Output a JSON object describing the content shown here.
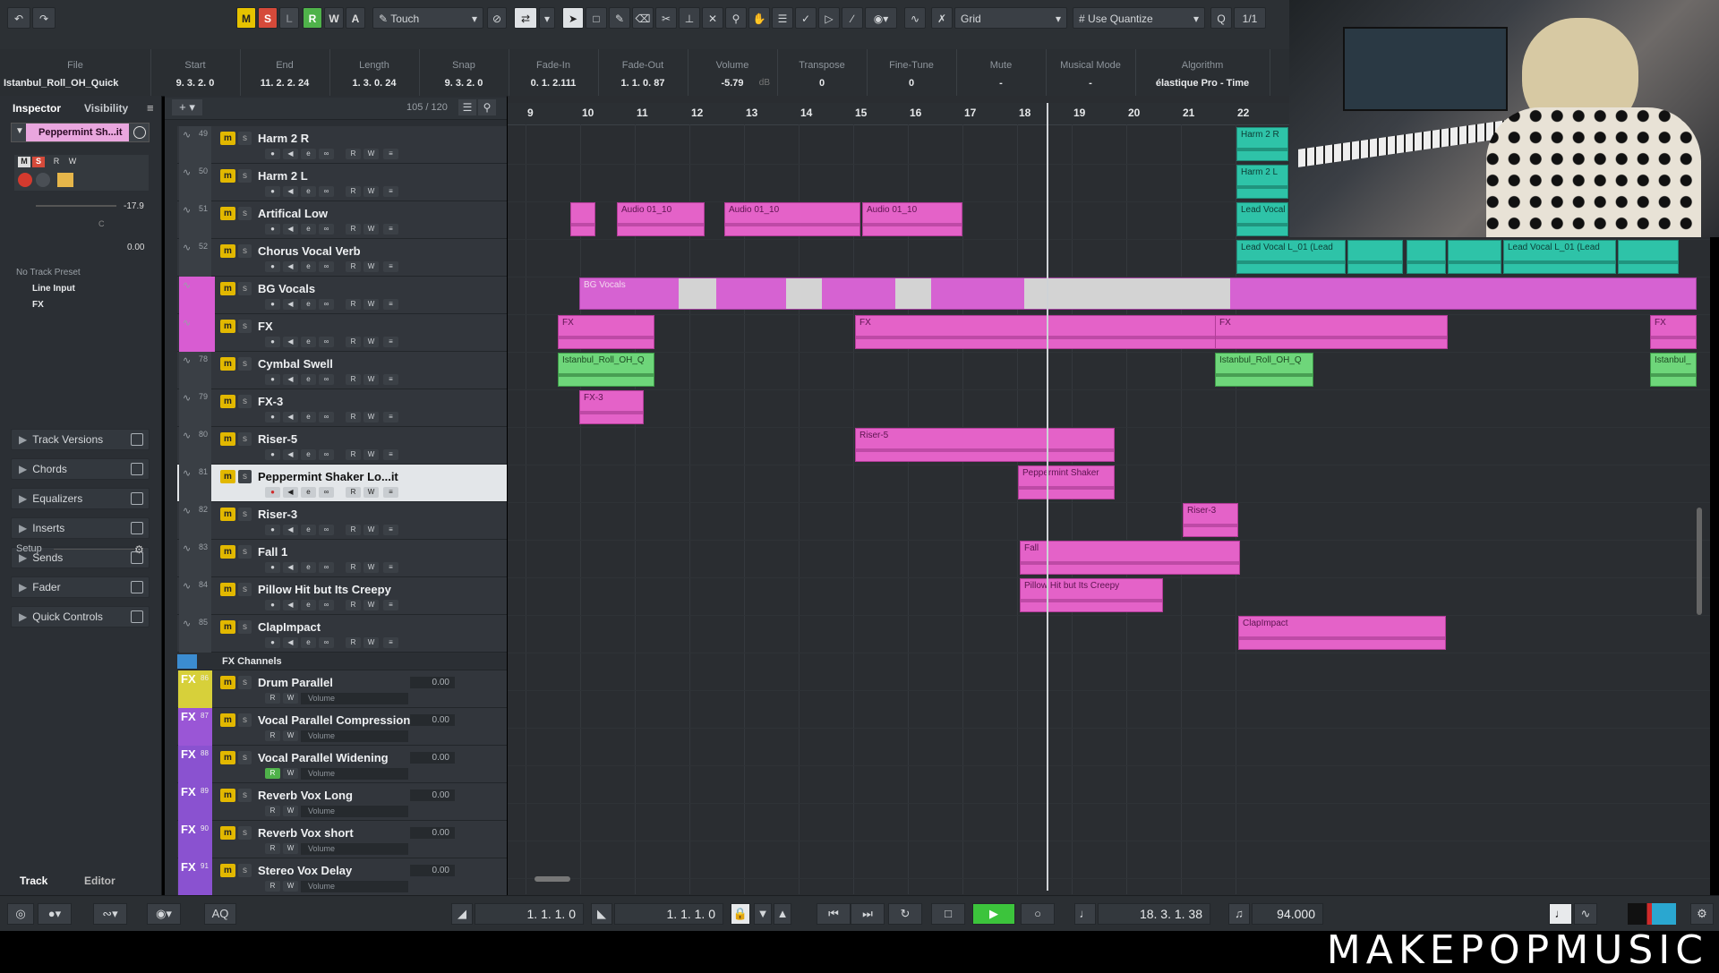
{
  "toolbar": {
    "undo_icon": "undo-icon",
    "redo_icon": "redo-icon",
    "m_label": "M",
    "s_label": "S",
    "l_label": "L",
    "r_label": "R",
    "w_label": "W",
    "a_label": "A",
    "automation_mode": "Touch",
    "snap_type": "Grid",
    "quantize": "Use Quantize",
    "quantize_value": "1/1"
  },
  "infoline": {
    "columns": [
      {
        "header": "File",
        "value": "Istanbul_Roll_OH_Quick"
      },
      {
        "header": "Start",
        "value": "9. 3. 2.   0"
      },
      {
        "header": "End",
        "value": "11. 2. 2. 24"
      },
      {
        "header": "Length",
        "value": "1. 3. 0. 24"
      },
      {
        "header": "Snap",
        "value": "9. 3. 2.   0"
      },
      {
        "header": "Fade-In",
        "value": "0.  1. 2.111"
      },
      {
        "header": "Fade-Out",
        "value": "1.  1. 0.  87"
      },
      {
        "header": "Volume",
        "value": "-5.79",
        "unit": "dB"
      },
      {
        "header": "Transpose",
        "value": "0"
      },
      {
        "header": "Fine-Tune",
        "value": "0"
      },
      {
        "header": "Mute",
        "value": "-"
      },
      {
        "header": "Musical Mode",
        "value": "-"
      },
      {
        "header": "Algorithm",
        "value": "élastique Pro - Time"
      }
    ]
  },
  "inspector": {
    "tab_inspector": "Inspector",
    "tab_visibility": "Visibility",
    "track_name": "Peppermint Sh...it",
    "volume_value": "-17.9",
    "pan_value": "C",
    "delay_value": "0.00",
    "preset": "No Track Preset",
    "input": "Line Input",
    "output": "FX",
    "sections": [
      "Track Versions",
      "Chords",
      "Equalizers",
      "Inserts",
      "Sends",
      "Fader",
      "Quick Controls"
    ],
    "setup_label": "Setup",
    "bottom_tab_track": "Track",
    "bottom_tab_editor": "Editor"
  },
  "tracklist": {
    "count": "105 / 120",
    "tracks": [
      {
        "num": "49",
        "name": "Harm 2 R"
      },
      {
        "num": "50",
        "name": "Harm 2 L"
      },
      {
        "num": "51",
        "name": "Artifical Low"
      },
      {
        "num": "52",
        "name": "Chorus Vocal Verb"
      },
      {
        "num": "",
        "name": "BG Vocals"
      },
      {
        "num": "",
        "name": "FX"
      },
      {
        "num": "78",
        "name": "Cymbal Swell"
      },
      {
        "num": "79",
        "name": "FX-3"
      },
      {
        "num": "80",
        "name": "Riser-5"
      },
      {
        "num": "81",
        "name": "Peppermint Shaker Lo...it"
      },
      {
        "num": "82",
        "name": "Riser-3"
      },
      {
        "num": "83",
        "name": "Fall 1"
      },
      {
        "num": "84",
        "name": "Pillow Hit but Its Creepy"
      },
      {
        "num": "85",
        "name": "ClapImpact"
      }
    ],
    "fx_folder": "FX Channels",
    "fx_channels": [
      {
        "num": "86",
        "name": "Drum Parallel",
        "vol": "0.00",
        "vol_label": "Volume"
      },
      {
        "num": "87",
        "name": "Vocal Parallel Compression",
        "vol": "0.00",
        "vol_label": "Volume"
      },
      {
        "num": "88",
        "name": "Vocal Parallel Widening",
        "vol": "0.00",
        "vol_label": "Volume"
      },
      {
        "num": "89",
        "name": "Reverb Vox Long",
        "vol": "0.00",
        "vol_label": "Volume"
      },
      {
        "num": "90",
        "name": "Reverb Vox short",
        "vol": "0.00",
        "vol_label": "Volume"
      },
      {
        "num": "91",
        "name": "Stereo Vox Delay",
        "vol": "0.00",
        "vol_label": "Volume"
      }
    ]
  },
  "ruler": {
    "bars": [
      "9",
      "10",
      "11",
      "12",
      "13",
      "14",
      "15",
      "16",
      "17",
      "18",
      "19",
      "20",
      "21",
      "22"
    ]
  },
  "clips": {
    "harm2r": "Harm 2 R",
    "harm2l": "Harm 2 L",
    "lead_vocal": "Lead Vocal",
    "lead_vocal_l01_a": "Lead Vocal L_01 (Lead",
    "lead_vocal_l01_b": "Lead Vocal L_01 (Lead",
    "audio_a": "Audio 01_10",
    "audio_b": "Audio 01_10",
    "audio_c": "Audio 01_10",
    "bg_vocals": "BG Vocals",
    "fx_a": "FX",
    "fx_b": "FX",
    "fx_c": "FX",
    "fx_d": "FX",
    "istanbul_a": "Istanbul_Roll_OH_Q",
    "istanbul_b": "Istanbul_Roll_OH_Q",
    "istanbul_c": "Istanbul_",
    "fx3": "FX-3",
    "riser5": "Riser-5",
    "peppermint": "Peppermint Shaker",
    "riser3": "Riser-3",
    "fall": "Fall",
    "pillow": "Pillow Hit but Its Creepy",
    "clapimpact": "ClapImpact"
  },
  "transport": {
    "left_locator": "1. 1. 1.   0",
    "right_locator": "1. 1. 1.   0",
    "position": "18. 3. 1. 38",
    "tempo": "94.000",
    "aq_label": "AQ"
  },
  "watermark": "MAKEPOPMUSIC",
  "colors": {
    "clip_pink": "#e462c8",
    "clip_green": "#6ed67a",
    "clip_teal": "#2ec3a8",
    "mute_yellow": "#e2b800",
    "play_green": "#3cc43c"
  }
}
